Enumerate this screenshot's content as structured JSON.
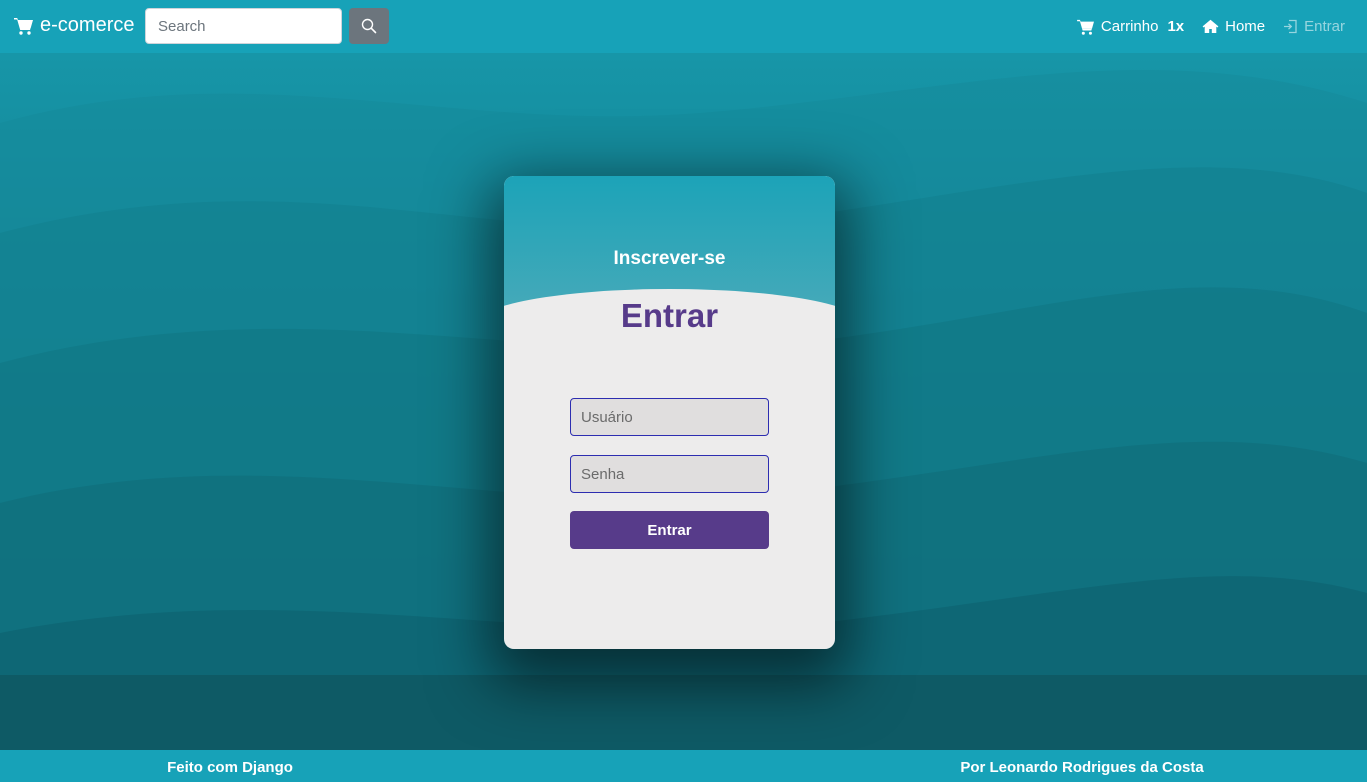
{
  "navbar": {
    "brand": "e-comerce",
    "brand_icon": "cart-icon",
    "search_placeholder": "Search",
    "search_icon": "search-icon",
    "cart_label": "Carrinho",
    "cart_count": "1x",
    "home_label": "Home",
    "login_label": "Entrar"
  },
  "card": {
    "signup_link": "Inscrever-se",
    "title": "Entrar",
    "username_placeholder": "Usuário",
    "password_placeholder": "Senha",
    "submit_label": "Entrar"
  },
  "footer": {
    "left": "Feito com Django",
    "right": "Por Leonardo Rodrigues da Costa"
  },
  "colors": {
    "primary": "#17a2b8",
    "accent": "#573b8a",
    "card_bg": "#edecec",
    "search_button": "#6c757d"
  }
}
